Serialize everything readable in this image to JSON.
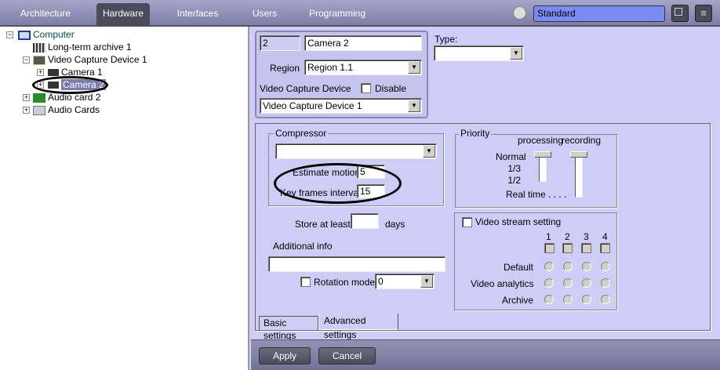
{
  "top_tabs": [
    "Architecture",
    "Hardware",
    "Interfaces",
    "Users",
    "Programming"
  ],
  "active_tab": "Hardware",
  "profile": "Standard",
  "tree": {
    "root": "Computer",
    "items": [
      "Long-term archive 1",
      "Video Capture Device 1",
      "Camera 1",
      "Camera 2",
      "Audio card 2",
      "Audio Cards"
    ]
  },
  "camera": {
    "id": "2",
    "name": "Camera 2",
    "region_label": "Region",
    "region": "Region 1.1",
    "device_label": "Video Capture Device",
    "disable_label": "Disable",
    "device": "Video Capture Device 1",
    "type_label": "Type:",
    "type": ""
  },
  "compressor": {
    "label": "Compressor",
    "value": "",
    "estimate_label": "Estimate motion",
    "estimate": "5",
    "key_label": "Key frames interval",
    "key": "15"
  },
  "store": {
    "label": "Store at least",
    "value": "",
    "unit": "days"
  },
  "additional": {
    "label": "Additional info",
    "value": ""
  },
  "rotation": {
    "label": "Rotation mode",
    "value": "0"
  },
  "priority": {
    "label": "Priority",
    "col1": "processing",
    "col2": "recording",
    "levels": [
      "Normal",
      "1/3",
      "1/2",
      "Real time . . . ."
    ]
  },
  "stream": {
    "label": "Video stream setting",
    "cols": [
      "1",
      "2",
      "3",
      "4"
    ],
    "rows": [
      "Default",
      "Video analytics",
      "Archive"
    ]
  },
  "settings_tabs": [
    "Basic settings",
    "Advanced settings"
  ],
  "buttons": {
    "apply": "Apply",
    "cancel": "Cancel"
  }
}
